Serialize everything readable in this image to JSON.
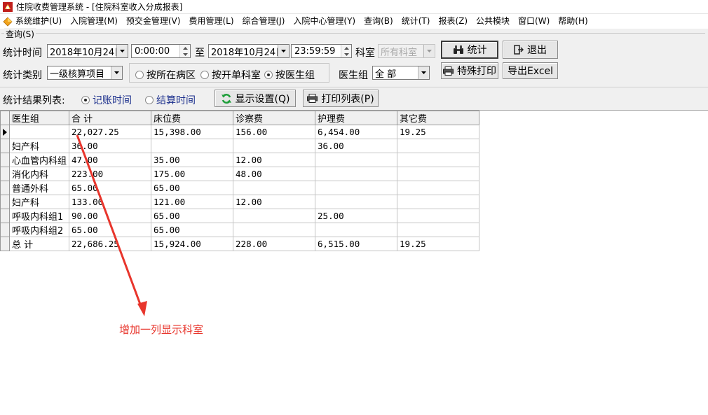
{
  "window": {
    "title": "住院收费管理系统 - [住院科室收入分成报表]"
  },
  "menu": [
    "系统维护(U)",
    "入院管理(M)",
    "预交金管理(V)",
    "费用管理(L)",
    "综合管理(J)",
    "入院中心管理(Y)",
    "查询(B)",
    "统计(T)",
    "报表(Z)",
    "公共模块",
    "窗口(W)",
    "帮助(H)"
  ],
  "query_group": {
    "label": "查询(S)"
  },
  "filters": {
    "time_label": "统计时间",
    "start_date": "2018年10月24日",
    "start_time": "0:00:00",
    "to_label": "至",
    "end_date": "2018年10月24日",
    "end_time": "23:59:59",
    "dept_label": "科室",
    "dept_value": "所有科室",
    "category_label": "统计类别",
    "category_value": "一级核算项目",
    "radio_ward": "按所在病区",
    "radio_bill_dept": "按开单科室",
    "radio_doctor_group": "按医生组",
    "doctor_group_label": "医生组",
    "doctor_group_value": "全 部"
  },
  "buttons": {
    "stats": "统计",
    "exit": "退出",
    "special_print": "特殊打印",
    "export_excel": "导出Excel",
    "display_settings": "显示设置(Q)",
    "print_list": "打印列表(P)"
  },
  "result": {
    "label": "统计结果列表:",
    "radio_account_time": "记账时间",
    "radio_settle_time": "结算时间"
  },
  "table": {
    "columns": [
      "医生组",
      "合 计",
      "床位费",
      "诊察费",
      "护理费",
      "其它费"
    ],
    "rows": [
      [
        "",
        "22,027.25",
        "15,398.00",
        "156.00",
        "6,454.00",
        "19.25"
      ],
      [
        "妇产科",
        "36.00",
        "",
        "",
        "36.00",
        ""
      ],
      [
        "心血管内科组",
        "47.00",
        "35.00",
        "12.00",
        "",
        ""
      ],
      [
        "消化内科",
        "223.00",
        "175.00",
        "48.00",
        "",
        ""
      ],
      [
        "普通外科",
        "65.00",
        "65.00",
        "",
        "",
        ""
      ],
      [
        "妇产科",
        "133.00",
        "121.00",
        "12.00",
        "",
        ""
      ],
      [
        "呼吸内科组1",
        "90.00",
        "65.00",
        "",
        "25.00",
        ""
      ],
      [
        "呼吸内科组2",
        "65.00",
        "65.00",
        "",
        "",
        ""
      ],
      [
        "总 计",
        "22,686.25",
        "15,924.00",
        "228.00",
        "6,515.00",
        "19.25"
      ]
    ]
  },
  "annotation": {
    "text": "增加一列显示科室",
    "color": "#e8352c"
  }
}
